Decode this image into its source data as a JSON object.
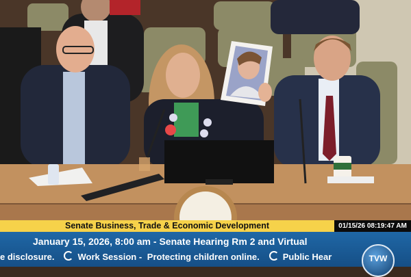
{
  "broadcast": {
    "committee_title": "Senate Business, Trade & Economic Development",
    "timestamp": "01/15/26 08:19:47 AM",
    "meeting_line": "January 15, 2026, 8:00 am - Senate Hearing Rm 2 and Virtual",
    "ticker_items": [
      "e disclosure.",
      "Work Session -",
      "Protecting children online.",
      "Public Hear"
    ],
    "logo_text": "TVW"
  },
  "scene": {
    "clock_label": "clock",
    "colors": {
      "desk": "#c2915f",
      "wall": "#5b3f2b",
      "chairs": "#8c8a67",
      "title_bar": "#f6d24a",
      "info_bar": "#1f67a6"
    }
  }
}
